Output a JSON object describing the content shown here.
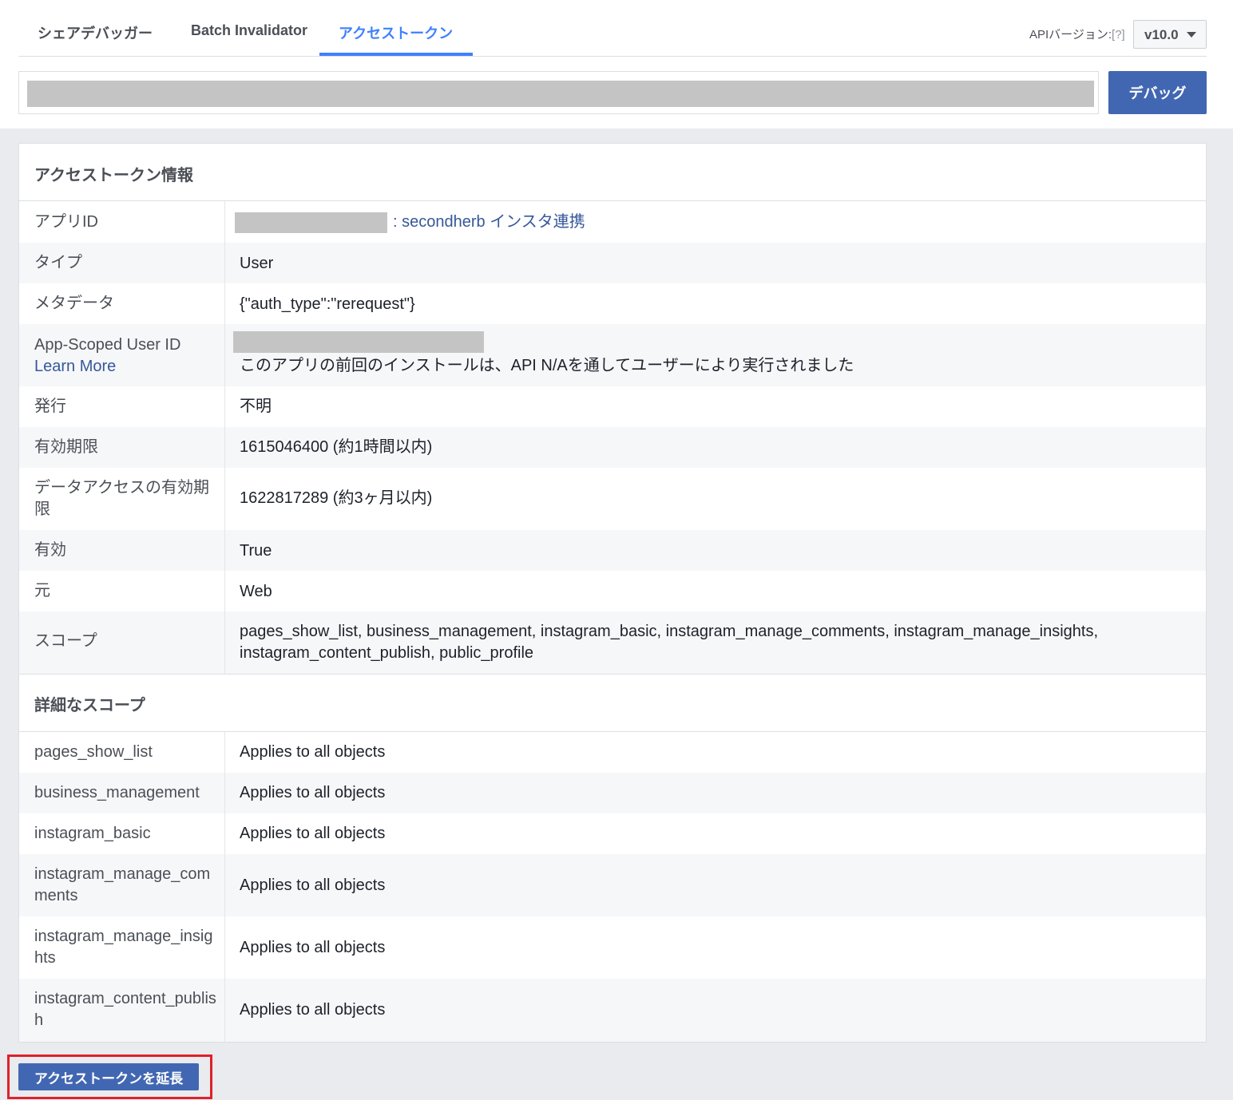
{
  "tabs": [
    {
      "label": "シェアデバッガー"
    },
    {
      "label": "Batch Invalidator"
    },
    {
      "label": "アクセストークン"
    }
  ],
  "api": {
    "label": "APIバージョン:",
    "help": "[?]",
    "version": "v10.0"
  },
  "debug_label": "デバッグ",
  "info": {
    "title": "アクセストークン情報",
    "app_id": {
      "key": "アプリID",
      "suffix": ": secondherb インスタ連携"
    },
    "type": {
      "key": "タイプ",
      "value": "User"
    },
    "metadata": {
      "key": "メタデータ",
      "value": "{\"auth_type\":\"rerequest\"}"
    },
    "user_id": {
      "key": "App-Scoped User ID",
      "learn_more": "Learn More",
      "note": "このアプリの前回のインストールは、API N/Aを通してユーザーにより実行されました"
    },
    "issued": {
      "key": "発行",
      "value": "不明"
    },
    "expires": {
      "key": "有効期限",
      "value": "1615046400 (約1時間以内)"
    },
    "data_access": {
      "key": "データアクセスの有効期限",
      "value": "1622817289 (約3ヶ月以内)"
    },
    "valid": {
      "key": "有効",
      "value": "True"
    },
    "origin": {
      "key": "元",
      "value": "Web"
    },
    "scopes": {
      "key": "スコープ",
      "line1": "pages_show_list, business_management, instagram_basic, instagram_manage_comments, instagram_manage_insights,",
      "line2": "instagram_content_publish, public_profile"
    }
  },
  "detail": {
    "title": "詳細なスコープ",
    "rows": [
      {
        "name": "pages_show_list",
        "value": "Applies to all objects"
      },
      {
        "name": "business_management",
        "value": "Applies to all objects"
      },
      {
        "name": "instagram_basic",
        "value": "Applies to all objects"
      },
      {
        "name": "instagram_manage_comments",
        "value": "Applies to all objects"
      },
      {
        "name": "instagram_manage_insights",
        "value": "Applies to all objects"
      },
      {
        "name": "instagram_content_publish",
        "value": "Applies to all objects"
      }
    ]
  },
  "extend_label": "アクセストークンを延長"
}
